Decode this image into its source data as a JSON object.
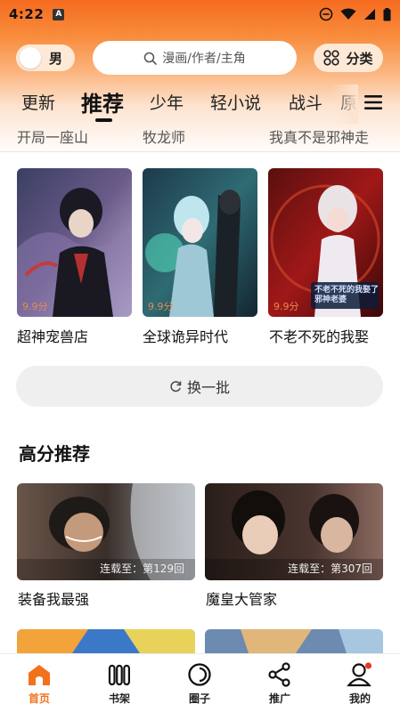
{
  "status_bar": {
    "time": "4:22",
    "app_icon_letter": "A"
  },
  "search_row": {
    "gender_label": "男",
    "search_placeholder": "漫画/作者/主角",
    "category_label": "分类"
  },
  "tabs": [
    {
      "label": "更新",
      "active": false
    },
    {
      "label": "推荐",
      "active": true
    },
    {
      "label": "少年",
      "active": false
    },
    {
      "label": "轻小说",
      "active": false
    },
    {
      "label": "战斗",
      "active": false
    },
    {
      "label": "原",
      "active": false
    }
  ],
  "previous_row_titles": [
    "开局一座山",
    "牧龙师",
    "我真不是邪神走"
  ],
  "featured": [
    {
      "title": "超神宠兽店",
      "score": "9.9分"
    },
    {
      "title": "全球诡异时代",
      "score": "9.9分"
    },
    {
      "title": "不老不死的我娶",
      "score": "9.9分",
      "cover_text": "不老不死的我娶了邪神老婆"
    }
  ],
  "refresh_label": "换一批",
  "high_score_section": {
    "title": "高分推荐",
    "items": [
      {
        "title": "装备我最强",
        "serial": "连载至：第129回"
      },
      {
        "title": "魔皇大管家",
        "serial": "连载至：第307回"
      }
    ]
  },
  "bottom_nav": [
    {
      "label": "首页",
      "icon": "home-icon",
      "active": true
    },
    {
      "label": "书架",
      "icon": "bookshelf-icon",
      "active": false
    },
    {
      "label": "圈子",
      "icon": "circle-icon",
      "active": false
    },
    {
      "label": "推广",
      "icon": "share-icon",
      "active": false
    },
    {
      "label": "我的",
      "icon": "profile-icon",
      "active": false
    }
  ],
  "colors": {
    "accent": "#f2711c",
    "header_orange": "#f56b1f",
    "score": "#e58a52"
  }
}
